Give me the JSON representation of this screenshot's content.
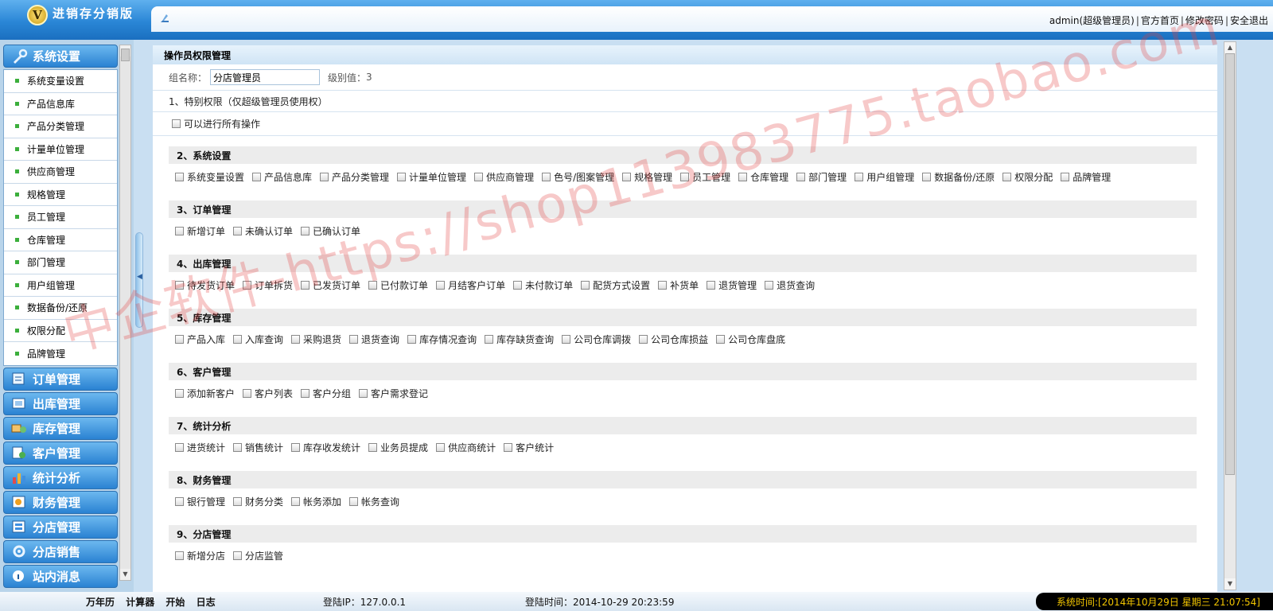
{
  "app": {
    "logo_letter": "V",
    "title": "进销存分销版"
  },
  "topbar": {
    "user": "admin(超级管理员)",
    "links": [
      "官方首页",
      "修改密码",
      "安全退出"
    ]
  },
  "sidebar": {
    "system_settings": {
      "label": "系统设置",
      "items": [
        "系统变量设置",
        "产品信息库",
        "产品分类管理",
        "计量单位管理",
        "供应商管理",
        "规格管理",
        "员工管理",
        "仓库管理",
        "部门管理",
        "用户组管理",
        "数据备份/还原",
        "权限分配",
        "品牌管理"
      ]
    },
    "menus": [
      {
        "label": "订单管理",
        "icon": "order-icon"
      },
      {
        "label": "出库管理",
        "icon": "outbound-icon"
      },
      {
        "label": "库存管理",
        "icon": "inventory-icon"
      },
      {
        "label": "客户管理",
        "icon": "customer-icon"
      },
      {
        "label": "统计分析",
        "icon": "chart-icon"
      },
      {
        "label": "财务管理",
        "icon": "finance-icon"
      },
      {
        "label": "分店管理",
        "icon": "branch-icon"
      },
      {
        "label": "分店销售",
        "icon": "branch-sales-icon"
      },
      {
        "label": "站内消息",
        "icon": "message-icon"
      }
    ]
  },
  "main": {
    "title": "操作员权限管理",
    "group_label": "组名称：",
    "group_value": "分店管理员",
    "level_label": "级别值：",
    "level_value": "3",
    "special_title": "1、特别权限（仅超级管理员使用权）",
    "special_option": "可以进行所有操作",
    "sections": [
      {
        "title": "2、系统设置",
        "items": [
          "系统变量设置",
          "产品信息库",
          "产品分类管理",
          "计量单位管理",
          "供应商管理",
          "色号/图案管理",
          "规格管理",
          "员工管理",
          "仓库管理",
          "部门管理",
          "用户组管理",
          "数据备份/还原",
          "权限分配",
          "品牌管理"
        ]
      },
      {
        "title": "3、订单管理",
        "items": [
          "新增订单",
          "未确认订单",
          "已确认订单"
        ]
      },
      {
        "title": "4、出库管理",
        "items": [
          "待发货订单",
          "订单拆货",
          "已发货订单",
          "已付款订单",
          "月结客户订单",
          "未付款订单",
          "配货方式设置",
          "补货单",
          "退货管理",
          "退货查询"
        ]
      },
      {
        "title": "5、库存管理",
        "items": [
          "产品入库",
          "入库查询",
          "采购退货",
          "退货查询",
          "库存情况查询",
          "库存缺货查询",
          "公司仓库调拨",
          "公司仓库损益",
          "公司仓库盘底"
        ]
      },
      {
        "title": "6、客户管理",
        "items": [
          "添加新客户",
          "客户列表",
          "客户分组",
          "客户需求登记"
        ]
      },
      {
        "title": "7、统计分析",
        "items": [
          "进货统计",
          "销售统计",
          "库存收发统计",
          "业务员提成",
          "供应商统计",
          "客户统计"
        ]
      },
      {
        "title": "8、财务管理",
        "items": [
          "银行管理",
          "财务分类",
          "帐务添加",
          "帐务查询"
        ]
      },
      {
        "title": "9、分店管理",
        "items": [
          "新增分店",
          "分店监管"
        ]
      }
    ]
  },
  "footer": {
    "links": [
      "万年历",
      "计算器",
      "开始",
      "日志"
    ],
    "login_ip": "登陆IP：127.0.0.1",
    "login_time": "登陆时间：2014-10-29 20:23:59",
    "system_time": "系统时间:[2014年10月29日 星期三 21:07:54]"
  },
  "watermark": "中企软件-https://shop113983775.taobao.com"
}
